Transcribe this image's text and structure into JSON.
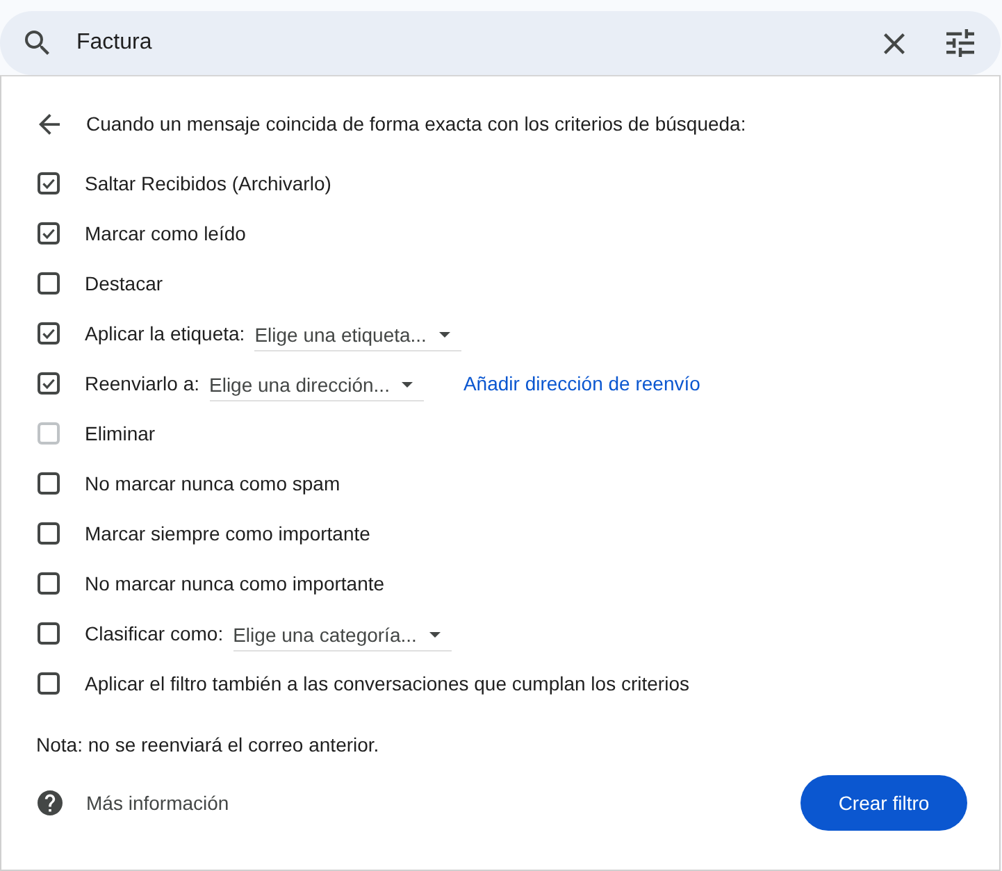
{
  "search": {
    "value": "Factura"
  },
  "filter": {
    "heading": "Cuando un mensaje coincida de forma exacta con los criterios de búsqueda:",
    "options": [
      {
        "kind": "checkbox",
        "label": "Saltar Recibidos (Archivarlo)",
        "checked": true,
        "disabled": false
      },
      {
        "kind": "checkbox",
        "label": "Marcar como leído",
        "checked": true,
        "disabled": false
      },
      {
        "kind": "checkbox",
        "label": "Destacar",
        "checked": false,
        "disabled": false
      },
      {
        "kind": "checkbox_select",
        "label": "Aplicar la etiqueta:",
        "select": "Elige una etiqueta...",
        "checked": true,
        "disabled": false
      },
      {
        "kind": "checkbox_select",
        "label": "Reenviarlo a:",
        "select": "Elige una dirección...",
        "link": "Añadir dirección de reenvío",
        "checked": true,
        "disabled": false
      },
      {
        "kind": "checkbox",
        "label": "Eliminar",
        "checked": false,
        "disabled": true
      },
      {
        "kind": "checkbox",
        "label": "No marcar nunca como spam",
        "checked": false,
        "disabled": false
      },
      {
        "kind": "checkbox",
        "label": "Marcar siempre como importante",
        "checked": false,
        "disabled": false
      },
      {
        "kind": "checkbox",
        "label": "No marcar nunca como importante",
        "checked": false,
        "disabled": false
      },
      {
        "kind": "checkbox_select",
        "label": "Clasificar como:",
        "select": "Elige una categoría...",
        "checked": false,
        "disabled": false
      },
      {
        "kind": "checkbox",
        "label": "Aplicar el filtro también a las conversaciones que cumplan los criterios",
        "checked": false,
        "disabled": false
      }
    ],
    "note": "Nota: no se reenviará el correo anterior.",
    "help_link": "Más información",
    "create_button": "Crear filtro"
  }
}
